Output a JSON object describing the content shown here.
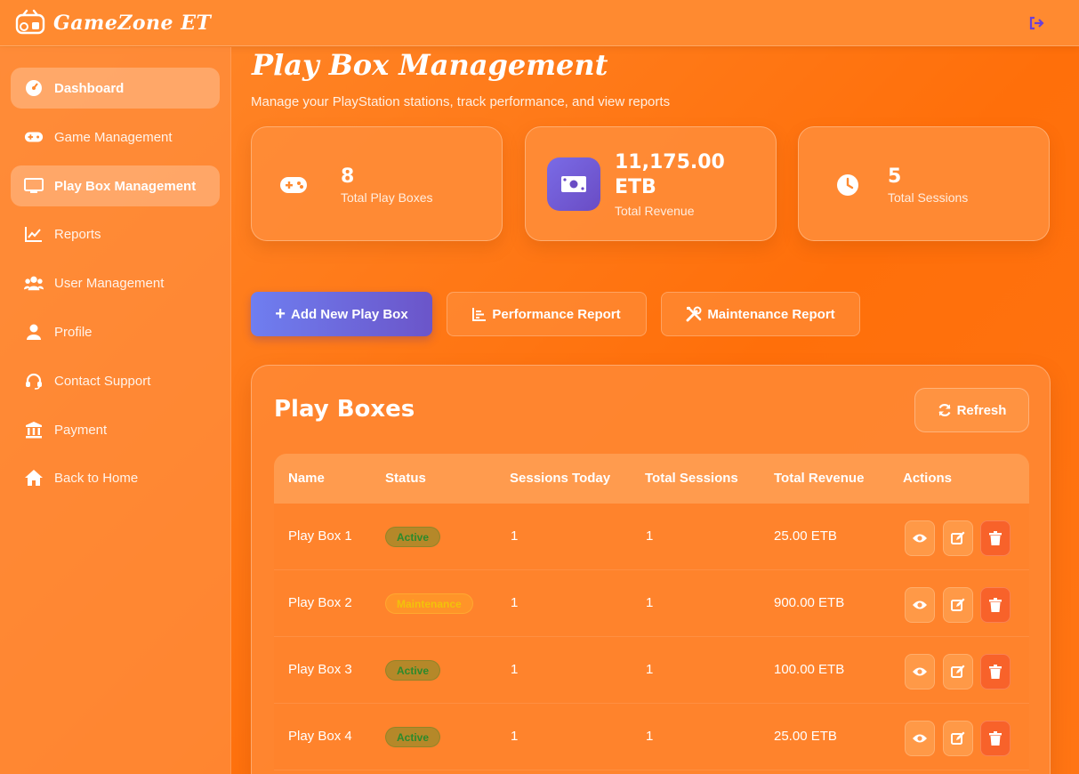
{
  "app": {
    "name": "GameZone ET"
  },
  "sidebar": {
    "items": [
      {
        "label": "Dashboard",
        "icon": "dashboard-icon"
      },
      {
        "label": "Game Management",
        "icon": "gamepad-icon"
      },
      {
        "label": "Play Box Management",
        "icon": "monitor-icon"
      },
      {
        "label": "Reports",
        "icon": "chart-line-icon"
      },
      {
        "label": "User Management",
        "icon": "users-icon"
      },
      {
        "label": "Profile",
        "icon": "user-icon"
      },
      {
        "label": "Contact Support",
        "icon": "headset-icon"
      },
      {
        "label": "Payment",
        "icon": "bank-icon"
      },
      {
        "label": "Back to Home",
        "icon": "home-icon"
      }
    ]
  },
  "page": {
    "title": "Play Box Management",
    "subtitle": "Manage your PlayStation stations, track performance, and view reports"
  },
  "stats": [
    {
      "value": "8",
      "label": "Total Play Boxes",
      "icon": "gamepad-icon"
    },
    {
      "value": "11,175.00 ETB",
      "value_line1": "11,175.00",
      "value_line2": "ETB",
      "label": "Total Revenue",
      "icon": "money-icon"
    },
    {
      "value": "5",
      "label": "Total Sessions",
      "icon": "clock-icon"
    }
  ],
  "actions": {
    "add": "Add New Play Box",
    "performance": "Performance Report",
    "maintenance": "Maintenance Report"
  },
  "panel": {
    "title": "Play Boxes",
    "refresh": "Refresh"
  },
  "table": {
    "headers": [
      "Name",
      "Status",
      "Sessions Today",
      "Total Sessions",
      "Total Revenue",
      "Actions"
    ],
    "rows": [
      {
        "name": "Play Box 1",
        "status": "Active",
        "sessions_today": "1",
        "total_sessions": "1",
        "revenue": "25.00 ETB"
      },
      {
        "name": "Play Box 2",
        "status": "Maintenance",
        "sessions_today": "1",
        "total_sessions": "1",
        "revenue": "900.00 ETB"
      },
      {
        "name": "Play Box 3",
        "status": "Active",
        "sessions_today": "1",
        "total_sessions": "1",
        "revenue": "100.00 ETB"
      },
      {
        "name": "Play Box 4",
        "status": "Active",
        "sessions_today": "1",
        "total_sessions": "1",
        "revenue": "25.00 ETB"
      }
    ]
  },
  "colors": {
    "background": "#ff7514",
    "primary_button": "#6b55c9",
    "active_badge_text": "#2c8a2c",
    "maintenance_badge_text": "#f2c20a",
    "delete_button": "#f8622a",
    "logout_icon": "#6a3fd8"
  }
}
